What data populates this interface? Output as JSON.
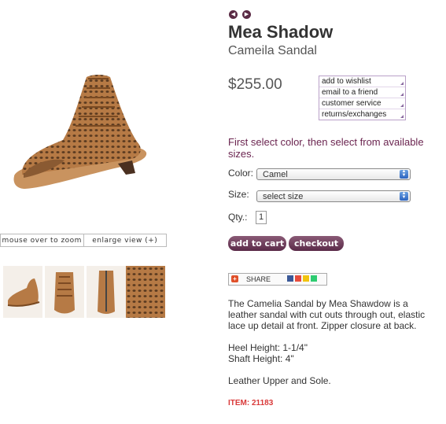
{
  "image": {
    "zoom_label": "mouse over to zoom",
    "enlarge_label": "enlarge view (+)"
  },
  "thumbnails": [
    "side-view",
    "front-view",
    "back-view",
    "detail-view"
  ],
  "product": {
    "brand": "Mea Shadow",
    "name": "Cameila Sandal",
    "price": "$255.00"
  },
  "links": [
    "add to wishlist",
    "email to a friend",
    "customer service",
    "returns/exchanges"
  ],
  "form": {
    "instructions": "First select color, then select from available sizes.",
    "color_label": "Color:",
    "color_value": "Camel",
    "size_label": "Size:",
    "size_value": "select size",
    "qty_label": "Qty.:",
    "qty_value": "1"
  },
  "buttons": {
    "add_to_cart": "add to cart",
    "checkout": "checkout"
  },
  "share": {
    "label": "SHARE"
  },
  "description": {
    "text": "The Camelia Sandal by Mea Shawdow is a leather sandal with cut outs through out, elastic lace up detail at front. Zipper closure at back.",
    "heel": "Heel Height: 1-1/4\"",
    "shaft": "Shaft Height: 4\"",
    "material": "Leather Upper and Sole."
  },
  "item_number": "ITEM: 21183",
  "colors": {
    "accent": "#5a2a48",
    "instructions": "#6b2550",
    "item": "#d93a3a",
    "leather": "#b67a45"
  }
}
